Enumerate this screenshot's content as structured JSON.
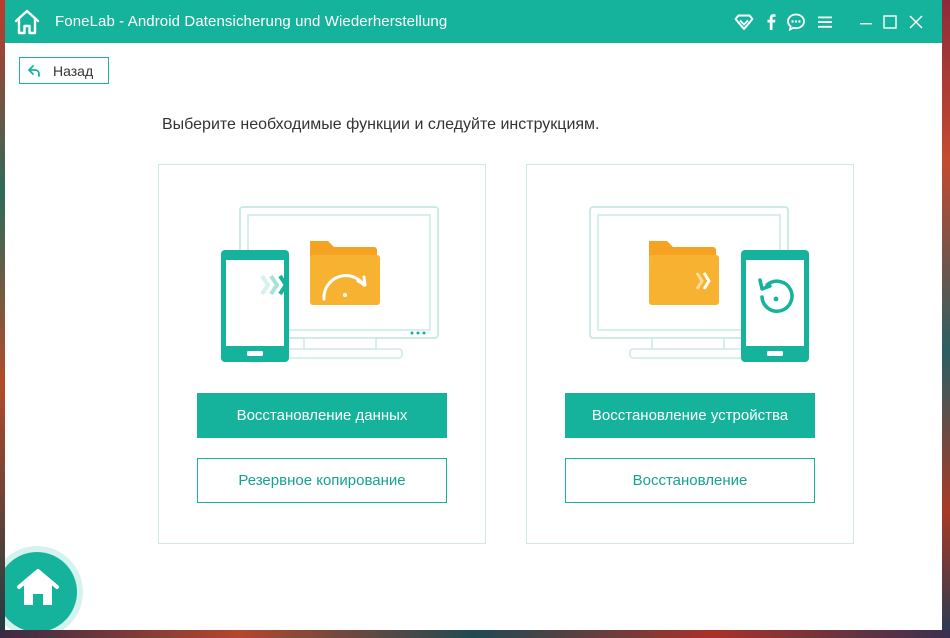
{
  "window": {
    "title": "FoneLab - Android Datensicherung und Wiederherstellung"
  },
  "titlebar_icons": [
    "wifi-icon",
    "facebook-icon",
    "chat-icon",
    "menu-icon",
    "minimize-icon",
    "maximize-icon",
    "close-icon"
  ],
  "back": {
    "label": "Назад"
  },
  "instruction": "Выберите необходимые функции и следуйте инструкциям.",
  "cards": [
    {
      "illustration": "phone-to-folder-restore",
      "primary_label": "Восстановление данных",
      "secondary_label": "Резервное копирование"
    },
    {
      "illustration": "folder-to-phone-restore",
      "primary_label": "Восстановление устройства",
      "secondary_label": "Восстановление"
    }
  ],
  "colors": {
    "accent": "#16b39c",
    "folder": "#f8b232",
    "device_outline": "#c7ecE6",
    "text": "#333333"
  }
}
